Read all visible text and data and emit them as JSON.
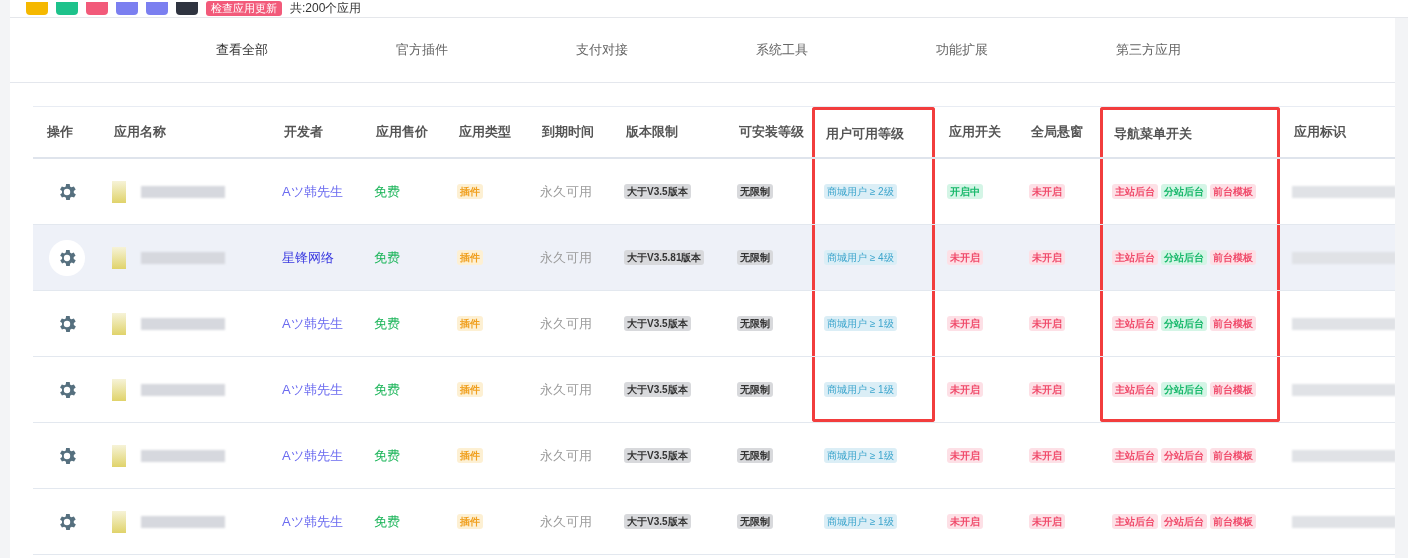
{
  "top_bar": {
    "update_badge": "检查应用更新",
    "total": "共:200个应用"
  },
  "tabs": [
    {
      "label": "查看全部",
      "selected": true
    },
    {
      "label": "官方插件",
      "selected": false
    },
    {
      "label": "支付对接",
      "selected": false
    },
    {
      "label": "系统工具",
      "selected": false
    },
    {
      "label": "功能扩展",
      "selected": false
    },
    {
      "label": "第三方应用",
      "selected": false
    }
  ],
  "table": {
    "columns": [
      {
        "label": "操作",
        "highlighted": false
      },
      {
        "label": "应用名称",
        "highlighted": false
      },
      {
        "label": "开发者",
        "highlighted": false
      },
      {
        "label": "应用售价",
        "highlighted": false
      },
      {
        "label": "应用类型",
        "highlighted": false
      },
      {
        "label": "到期时间",
        "highlighted": false
      },
      {
        "label": "版本限制",
        "highlighted": false
      },
      {
        "label": "可安装等级",
        "highlighted": false
      },
      {
        "label": "用户可用等级",
        "highlighted": true
      },
      {
        "label": "应用开关",
        "highlighted": false
      },
      {
        "label": "全局悬窗",
        "highlighted": false
      },
      {
        "label": "导航菜单开关",
        "highlighted": true
      },
      {
        "label": "应用标识",
        "highlighted": false
      }
    ],
    "rows": [
      {
        "selected": false,
        "highlighted": true,
        "developer": "Aツ韩先生",
        "color": "#6b6bf0",
        "price": "免费",
        "type": "插件",
        "expiry": "永久可用",
        "version": "大于V3.5版本",
        "install_level": "无限制",
        "user_level": "商城用户 ≥ 2级",
        "app_switch": {
          "label": "开启中",
          "on": true
        },
        "float_window": {
          "label": "未开启",
          "on": false
        },
        "nav": [
          {
            "label": "主站后台",
            "on": false
          },
          {
            "label": "分站后台",
            "on": true
          },
          {
            "label": "前台模板",
            "on": false
          }
        ]
      },
      {
        "selected": true,
        "highlighted": true,
        "developer": "星锋网络",
        "color": "#3a3ae0",
        "price": "免费",
        "type": "插件",
        "expiry": "永久可用",
        "version": "大于V3.5.81版本",
        "install_level": "无限制",
        "user_level": "商城用户 ≥ 4级",
        "app_switch": {
          "label": "未开启",
          "on": false
        },
        "float_window": {
          "label": "未开启",
          "on": false
        },
        "nav": [
          {
            "label": "主站后台",
            "on": false
          },
          {
            "label": "分站后台",
            "on": true
          },
          {
            "label": "前台模板",
            "on": false
          }
        ]
      },
      {
        "selected": false,
        "highlighted": true,
        "developer": "Aツ韩先生",
        "color": "#6b6bf0",
        "price": "免费",
        "type": "插件",
        "expiry": "永久可用",
        "version": "大于V3.5版本",
        "install_level": "无限制",
        "user_level": "商城用户 ≥ 1级",
        "app_switch": {
          "label": "未开启",
          "on": false
        },
        "float_window": {
          "label": "未开启",
          "on": false
        },
        "nav": [
          {
            "label": "主站后台",
            "on": false
          },
          {
            "label": "分站后台",
            "on": true
          },
          {
            "label": "前台模板",
            "on": false
          }
        ]
      },
      {
        "selected": false,
        "highlighted": true,
        "developer": "Aツ韩先生",
        "color": "#6b6bf0",
        "price": "免费",
        "type": "插件",
        "expiry": "永久可用",
        "version": "大于V3.5版本",
        "install_level": "无限制",
        "user_level": "商城用户 ≥ 1级",
        "app_switch": {
          "label": "未开启",
          "on": false
        },
        "float_window": {
          "label": "未开启",
          "on": false
        },
        "nav": [
          {
            "label": "主站后台",
            "on": false
          },
          {
            "label": "分站后台",
            "on": true
          },
          {
            "label": "前台模板",
            "on": false
          }
        ]
      },
      {
        "selected": false,
        "highlighted": false,
        "developer": "Aツ韩先生",
        "color": "#6b6bf0",
        "price": "免费",
        "type": "插件",
        "expiry": "永久可用",
        "version": "大于V3.5版本",
        "install_level": "无限制",
        "user_level": "商城用户 ≥ 1级",
        "app_switch": {
          "label": "未开启",
          "on": false
        },
        "float_window": {
          "label": "未开启",
          "on": false
        },
        "nav": [
          {
            "label": "主站后台",
            "on": false
          },
          {
            "label": "分站后台",
            "on": false
          },
          {
            "label": "前台模板",
            "on": false
          }
        ]
      },
      {
        "selected": false,
        "highlighted": false,
        "developer": "Aツ韩先生",
        "color": "#6b6bf0",
        "price": "免费",
        "type": "插件",
        "expiry": "永久可用",
        "version": "大于V3.5版本",
        "install_level": "无限制",
        "user_level": "商城用户 ≥ 1级",
        "app_switch": {
          "label": "未开启",
          "on": false
        },
        "float_window": {
          "label": "未开启",
          "on": false
        },
        "nav": [
          {
            "label": "主站后台",
            "on": false
          },
          {
            "label": "分站后台",
            "on": false
          },
          {
            "label": "前台模板",
            "on": false
          }
        ]
      }
    ]
  }
}
